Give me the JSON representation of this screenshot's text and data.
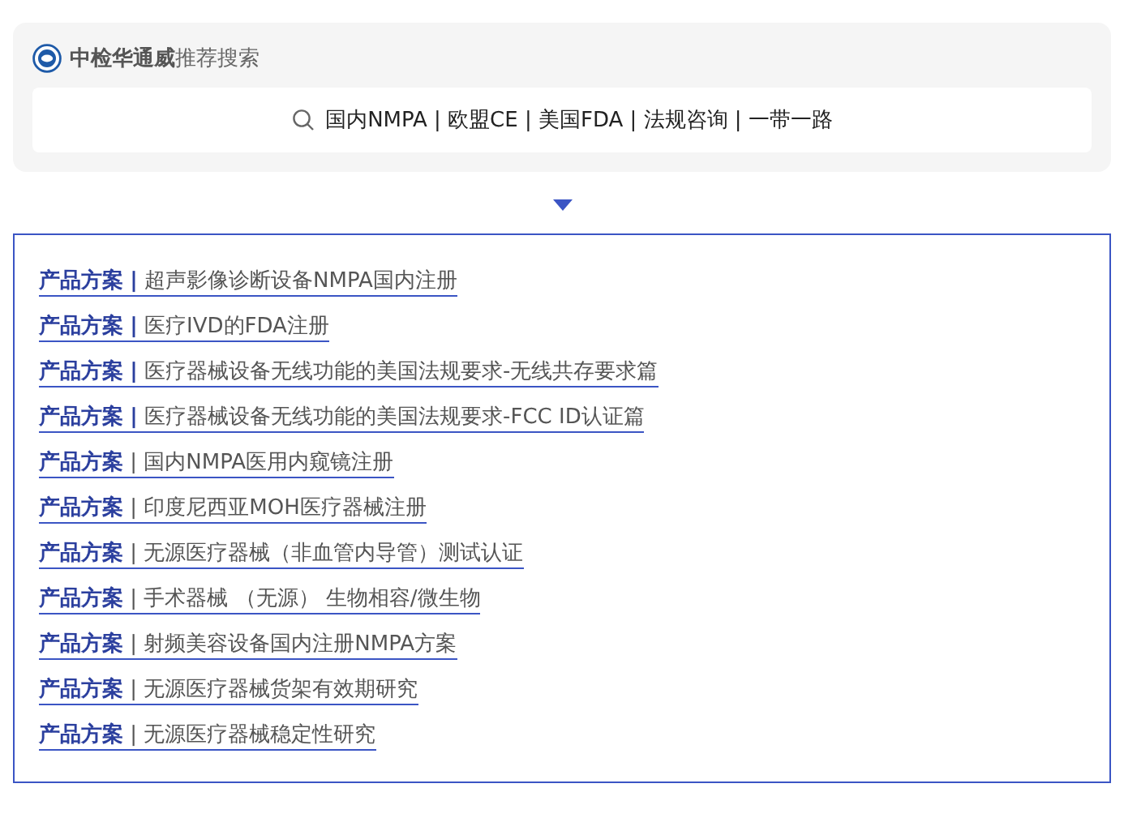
{
  "header": {
    "title": "**中检华通威**推荐搜索"
  },
  "search": {
    "value": "国内NMPA | 欧盟CE | 美国FDA | 法规咨询 | 一带一路"
  },
  "links": [
    {
      "kind": "bold",
      "category": "产品方案",
      "separator": "|",
      "title": "超声影像诊断设备NMPA国内注册"
    },
    {
      "kind": "bold",
      "category": "产品方案",
      "separator": "|",
      "title": "医疗IVD的FDA注册"
    },
    {
      "kind": "bold",
      "category": "产品方案",
      "separator": "|",
      "title": "医疗器械设备无线功能的美国法规要求-无线共存要求篇"
    },
    {
      "kind": "bold",
      "category": "产品方案",
      "separator": "|",
      "title": "医疗器械设备无线功能的美国法规要求-FCC ID认证篇"
    },
    {
      "kind": "thin",
      "category": "产品方案",
      "separator": "|",
      "title": "国内NMPA医用内窥镜注册"
    },
    {
      "kind": "thin",
      "category": "产品方案",
      "separator": "|",
      "title": "印度尼西亚MOH医疗器械注册"
    },
    {
      "kind": "thin",
      "category": "产品方案",
      "separator": "|",
      "title": "无源医疗器械（非血管内导管）测试认证"
    },
    {
      "kind": "thin",
      "category": "产品方案",
      "separator": "|",
      "title": "手术器械 （无源） 生物相容/微生物"
    },
    {
      "kind": "thin",
      "category": "产品方案",
      "separator": "|",
      "title": "射频美容设备国内注册NMPA方案"
    },
    {
      "kind": "thin",
      "category": "产品方案",
      "separator": "|",
      "title": "无源医疗器械货架有效期研究"
    },
    {
      "kind": "thin",
      "category": "产品方案",
      "separator": "|",
      "title": "无源医疗器械稳定性研究"
    }
  ]
}
